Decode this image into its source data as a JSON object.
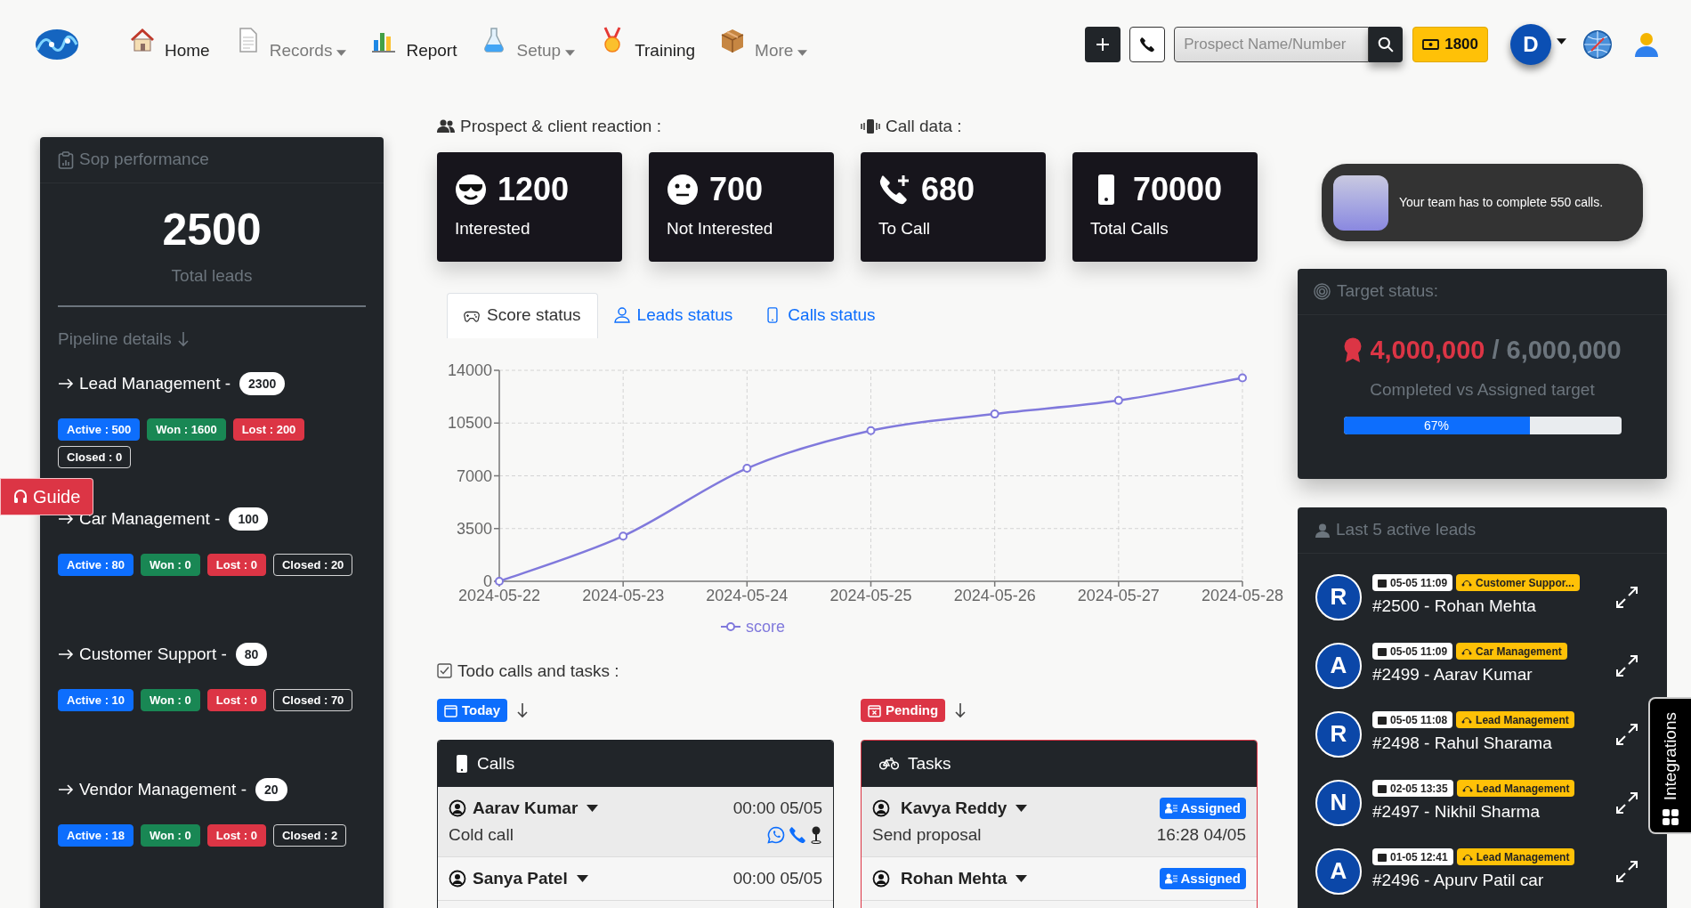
{
  "nav": {
    "items": [
      {
        "label": "Home",
        "dropdown": false
      },
      {
        "label": "Records",
        "dropdown": true
      },
      {
        "label": "Report",
        "dropdown": false
      },
      {
        "label": "Setup",
        "dropdown": true
      },
      {
        "label": "Training",
        "dropdown": false
      },
      {
        "label": "More",
        "dropdown": true
      }
    ],
    "search": {
      "placeholder": "Prospect Name/Number"
    },
    "credits": "1800",
    "avatar": "D"
  },
  "sop": {
    "title": "Sop performance",
    "total": "2500",
    "total_label": "Total leads",
    "pipeline_heading": "Pipeline details",
    "pipelines": [
      {
        "name": "Lead Management -",
        "count": "2300",
        "badges": [
          {
            "kind": "active",
            "label": "Active : 500"
          },
          {
            "kind": "won",
            "label": "Won : 1600"
          },
          {
            "kind": "lost",
            "label": "Lost : 200"
          },
          {
            "kind": "closed",
            "label": "Closed : 0"
          }
        ]
      },
      {
        "name": "Car Management -",
        "count": "100",
        "badges": [
          {
            "kind": "active",
            "label": "Active : 80"
          },
          {
            "kind": "won",
            "label": "Won : 0"
          },
          {
            "kind": "lost",
            "label": "Lost : 0"
          },
          {
            "kind": "closed",
            "label": "Closed : 20"
          }
        ]
      },
      {
        "name": "Customer Support -",
        "count": "80",
        "badges": [
          {
            "kind": "active",
            "label": "Active : 10"
          },
          {
            "kind": "won",
            "label": "Won : 0"
          },
          {
            "kind": "lost",
            "label": "Lost : 0"
          },
          {
            "kind": "closed",
            "label": "Closed : 70"
          }
        ]
      },
      {
        "name": "Vendor Management -",
        "count": "20",
        "badges": [
          {
            "kind": "active",
            "label": "Active : 18"
          },
          {
            "kind": "won",
            "label": "Won : 0"
          },
          {
            "kind": "lost",
            "label": "Lost : 0"
          },
          {
            "kind": "closed",
            "label": "Closed : 2"
          }
        ]
      }
    ]
  },
  "guide": "Guide",
  "reaction": {
    "heading": "Prospect & client reaction :",
    "stats": [
      {
        "value": "1200",
        "label": "Interested"
      },
      {
        "value": "700",
        "label": "Not Interested"
      }
    ]
  },
  "call_data": {
    "heading": "Call data :",
    "stats": [
      {
        "value": "680",
        "label": "To Call"
      },
      {
        "value": "70000",
        "label": "Total Calls"
      }
    ]
  },
  "tabs": [
    {
      "label": "Score status",
      "selected": true
    },
    {
      "label": "Leads status",
      "selected": false
    },
    {
      "label": "Calls status",
      "selected": false
    }
  ],
  "chart_data": {
    "type": "line",
    "categories": [
      "2024-05-22",
      "2024-05-23",
      "2024-05-24",
      "2024-05-25",
      "2024-05-26",
      "2024-05-27",
      "2024-05-28"
    ],
    "series": [
      {
        "name": "score",
        "color": "#8079dc",
        "marker": true,
        "values": [
          0,
          3000,
          7500,
          10000,
          11100,
          12000,
          13500
        ]
      }
    ],
    "grid": true,
    "ylim": [
      0,
      14000
    ],
    "yticks": [
      0,
      3500,
      7000,
      10500,
      14000
    ]
  },
  "todo": {
    "heading": "Todo calls and tasks :"
  },
  "calls": {
    "filter": "Today",
    "title": "Calls",
    "rows": [
      {
        "name": "Aarav Kumar",
        "time": "00:00 05/05",
        "type": "Cold call"
      },
      {
        "name": "Sanya Patel",
        "time": "00:00 05/05"
      }
    ]
  },
  "tasks": {
    "filter": "Pending",
    "title": "Tasks",
    "rows": [
      {
        "name": "Kavya Reddy",
        "status": "Assigned",
        "task": "Send proposal",
        "time": "16:28 04/05"
      },
      {
        "name": "Rohan Mehta",
        "status": "Assigned"
      }
    ]
  },
  "toast": "Your team has to complete 550 calls.",
  "target": {
    "title": "Target status:",
    "completed": "4,000,000",
    "assigned": "/ 6,000,000",
    "caption": "Completed vs Assigned target",
    "level": 0.67,
    "reading": "67%"
  },
  "leads": {
    "title": "Last 5 active leads",
    "rows": [
      {
        "initial": "R",
        "date": "05-05 11:09",
        "pipeline": "Customer Suppor...",
        "name": "#2500 - Rohan Mehta"
      },
      {
        "initial": "A",
        "date": "05-05 11:09",
        "pipeline": "Car Management",
        "name": "#2499 - Aarav Kumar"
      },
      {
        "initial": "R",
        "date": "05-05 11:08",
        "pipeline": "Lead Management",
        "name": "#2498 - Rahul Sharama"
      },
      {
        "initial": "N",
        "date": "02-05 13:35",
        "pipeline": "Lead Management",
        "name": "#2497 - Nikhil Sharma"
      },
      {
        "initial": "A",
        "date": "01-05 12:41",
        "pipeline": "Lead Management",
        "name": "#2496 - Apurv Patil car"
      }
    ]
  },
  "integrations": "Integrations"
}
